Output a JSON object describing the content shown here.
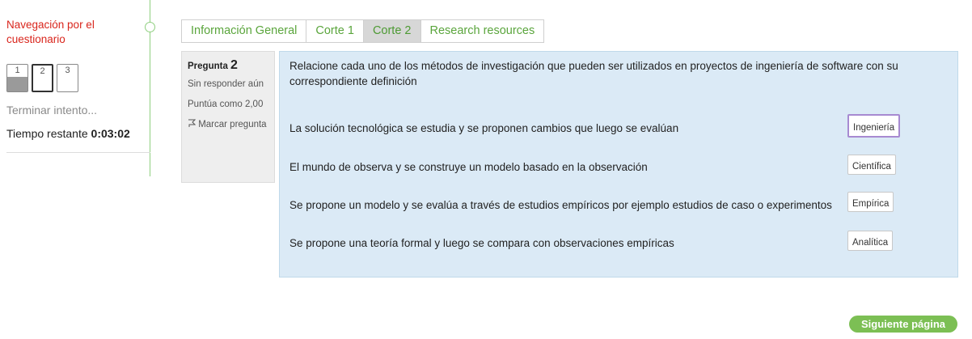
{
  "nav": {
    "title": "Navegación por el cuestionario",
    "questions": [
      "1",
      "2",
      "3"
    ],
    "finish_label": "Terminar intento...",
    "timer_label": "Tiempo restante",
    "timer_value": "0:03:02"
  },
  "tabs": [
    "Información General",
    "Corte 1",
    "Corte 2",
    "Research resources"
  ],
  "question_info": {
    "label": "Pregunta",
    "number": "2",
    "state": "Sin responder aún",
    "grade": "Puntúa como 2,00",
    "flag_label": "Marcar pregunta"
  },
  "question": {
    "text": "Relacione cada uno de los métodos de investigación que pueden ser utilizados en proyectos de ingeniería de software con su correspondiente definición",
    "rows": [
      {
        "text": "La solución tecnológica se estudia y se proponen cambios que luego se evalúan",
        "answer": "Ingeniería"
      },
      {
        "text": "El mundo de observa y se construye un modelo basado en la observación",
        "answer": "Científica"
      },
      {
        "text": "Se propone un modelo y se evalúa a través de estudios empíricos por ejemplo estudios de caso o experimentos",
        "answer": "Empírica"
      },
      {
        "text": "Se propone una teoría formal y luego se compara con observaciones empíricas",
        "answer": "Analítica"
      }
    ]
  },
  "next_label": "Siguiente página",
  "colors": {
    "accent_green": "#5aa53c",
    "nav_title_red": "#d9251c",
    "content_bg": "#dbeaf6",
    "next_bg": "#7cbf54",
    "focus_purple": "#a78ad1"
  }
}
